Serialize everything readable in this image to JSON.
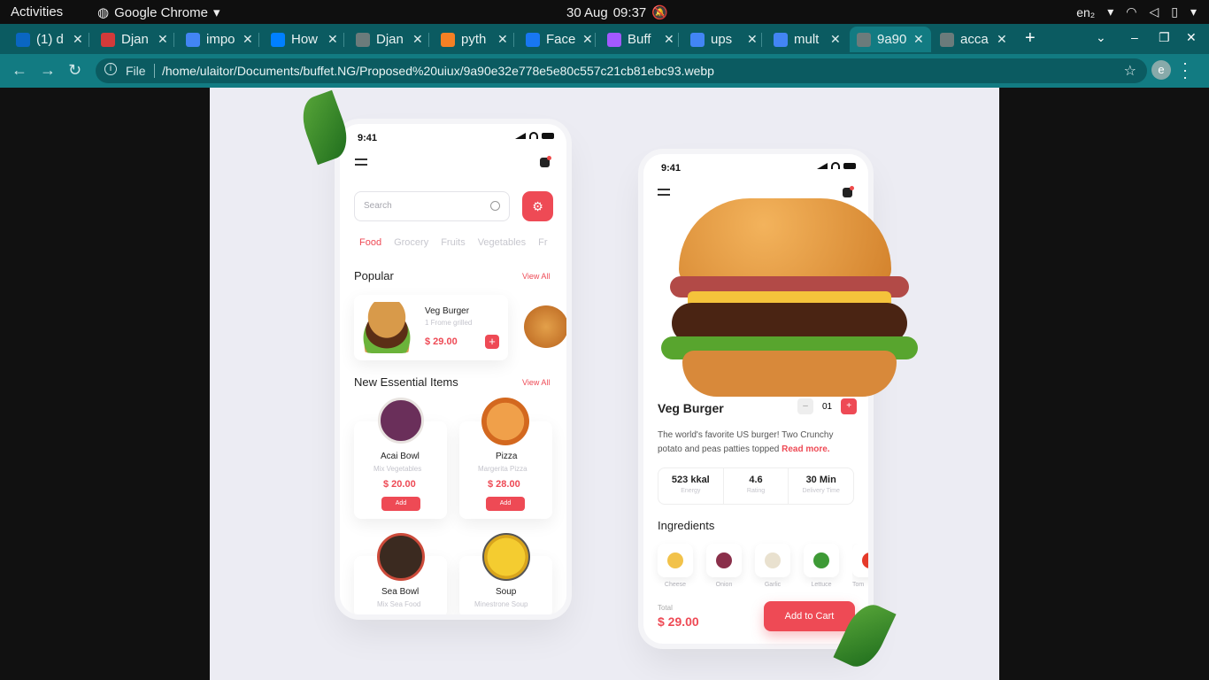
{
  "gnome": {
    "activities": "Activities",
    "app_name": "Google Chrome",
    "date": "30 Aug",
    "time": "09:37",
    "input_method": "en₂"
  },
  "tabs": [
    {
      "label": "(1) d",
      "icon": "linkedin-icon",
      "color": "#0a66c2"
    },
    {
      "label": "Djan",
      "icon": "django-icon",
      "color": "#d33a3a"
    },
    {
      "label": "impo",
      "icon": "google-icon",
      "color": "#4285f4"
    },
    {
      "label": "How",
      "icon": "digitalocean-icon",
      "color": "#0080ff"
    },
    {
      "label": "Djan",
      "icon": "globe-icon",
      "color": "#6b7b7b"
    },
    {
      "label": "pyth",
      "icon": "stackoverflow-icon",
      "color": "#f48024"
    },
    {
      "label": "Face",
      "icon": "facebook-icon",
      "color": "#1877f2"
    },
    {
      "label": "Buff",
      "icon": "figma-icon",
      "color": "#a259ff"
    },
    {
      "label": "ups",
      "icon": "google-icon",
      "color": "#4285f4"
    },
    {
      "label": "mult",
      "icon": "google-icon",
      "color": "#4285f4"
    },
    {
      "label": "9a90",
      "icon": "globe-icon",
      "color": "#6b7b7b"
    },
    {
      "label": "acca",
      "icon": "globe-icon",
      "color": "#6b7b7b"
    }
  ],
  "toolbar": {
    "file_label": "File",
    "url": "/home/ulaitor/Documents/buffet.NG/Proposed%20uiux/9a90e32e778e5e80c557c21cb81ebc93.webp",
    "profile_initial": "e"
  },
  "left_phone": {
    "time": "9:41",
    "search_placeholder": "Search",
    "categories": [
      "Food",
      "Grocery",
      "Fruits",
      "Vegetables",
      "Fr"
    ],
    "popular_title": "Popular",
    "view_all": "View All",
    "popular_item": {
      "name": "Veg Burger",
      "sub": "1 Frome grilled",
      "price": "$ 29.00"
    },
    "new_title": "New Essential Items",
    "items": [
      {
        "name": "Acai Bowl",
        "sub": "Mix Vegetables",
        "price": "$ 20.00",
        "add": "Add",
        "color": "#6a2f5a"
      },
      {
        "name": "Pizza",
        "sub": "Margerita Pizza",
        "price": "$ 28.00",
        "add": "Add",
        "color": "#e5752c"
      },
      {
        "name": "Sea Bowl",
        "sub": "Mix Sea Food",
        "color": "#3b2a20"
      },
      {
        "name": "Soup",
        "sub": "Minestrone Soup",
        "color": "#f2c42b"
      }
    ]
  },
  "right_phone": {
    "time": "9:41",
    "title": "Veg Burger",
    "quantity": "01",
    "description": "The world's favorite US burger! Two Crunchy potato and peas patties topped",
    "read_more": "Read more.",
    "stats": [
      {
        "value": "523 kkal",
        "label": "Energy"
      },
      {
        "value": "4.6",
        "label": "Rating"
      },
      {
        "value": "30 Min",
        "label": "Delivery Time"
      }
    ],
    "ingredients_title": "Ingredients",
    "ingredients": [
      {
        "label": "Cheese",
        "color": "#f2c24a"
      },
      {
        "label": "Onion",
        "color": "#8a2f4a"
      },
      {
        "label": "Garlic",
        "color": "#e9e1cf"
      },
      {
        "label": "Lettuce",
        "color": "#3e9a36"
      },
      {
        "label": "Tom",
        "color": "#e53a2a"
      }
    ],
    "total_label": "Total",
    "total_value": "$ 29.00",
    "cart_label": "Add to Cart"
  }
}
